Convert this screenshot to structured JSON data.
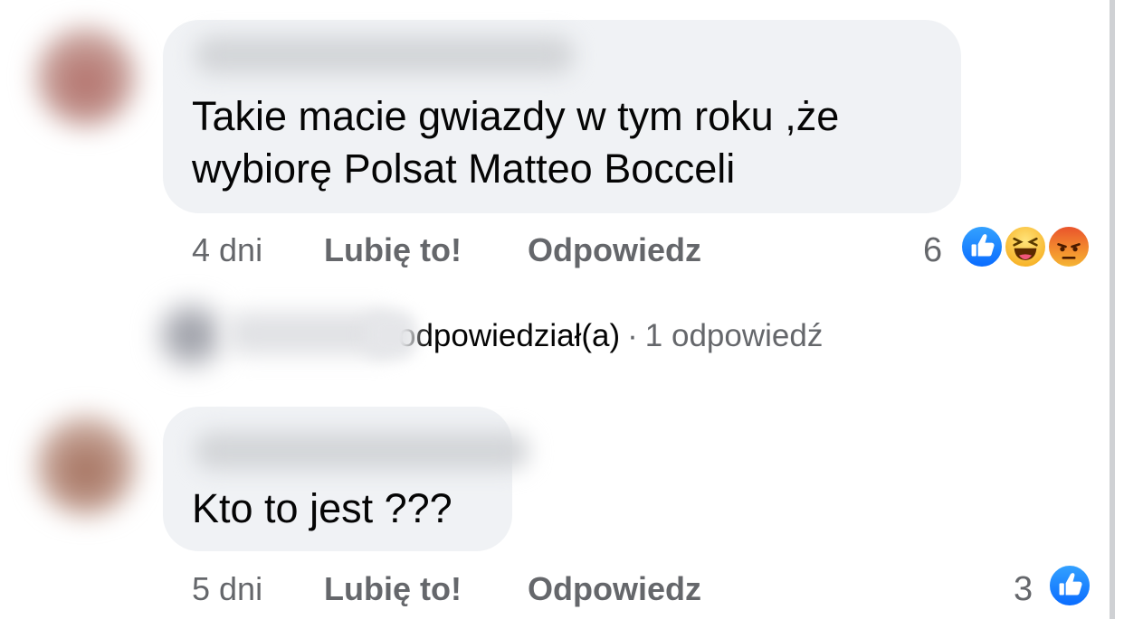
{
  "comments": [
    {
      "text_line1": "Takie macie gwiazdy w tym roku ,że",
      "text_line2": "wybiorę Polsat Matteo Bocceli",
      "time": "4 dni",
      "like_label": "Lubię to!",
      "reply_label": "Odpowiedz",
      "reaction_count": "6",
      "reactions": [
        "like-icon",
        "haha-icon",
        "angry-icon"
      ]
    },
    {
      "text_line1": "Kto to jest ???",
      "time": "5 dni",
      "like_label": "Lubię to!",
      "reply_label": "Odpowiedz",
      "reaction_count": "3",
      "reactions": [
        "like-icon"
      ]
    }
  ],
  "replies": {
    "label": "odpowiedział(a)",
    "separator": "·",
    "count_text": "1 odpowiedź"
  },
  "colors": {
    "bubble": "#f0f2f5",
    "secondary_text": "#65676b",
    "primary_text": "#050505",
    "like_blue": "#0a6cff"
  }
}
